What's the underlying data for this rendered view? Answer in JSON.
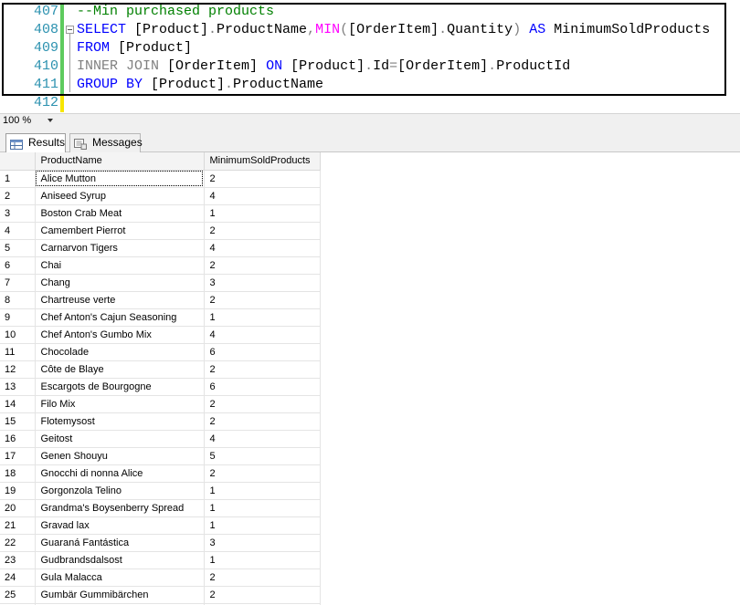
{
  "editor": {
    "lines": [
      {
        "number": "407",
        "tokens": [
          {
            "cls": "c",
            "text": "--Min purchased products"
          }
        ]
      },
      {
        "number": "408",
        "tokens": [
          {
            "cls": "k",
            "text": "SELECT "
          },
          {
            "cls": "t",
            "text": "[Product]"
          },
          {
            "cls": "g",
            "text": "."
          },
          {
            "cls": "t",
            "text": "ProductName"
          },
          {
            "cls": "g",
            "text": ","
          },
          {
            "cls": "f",
            "text": "MIN"
          },
          {
            "cls": "g",
            "text": "("
          },
          {
            "cls": "t",
            "text": "[OrderItem]"
          },
          {
            "cls": "g",
            "text": "."
          },
          {
            "cls": "t",
            "text": "Quantity"
          },
          {
            "cls": "g",
            "text": ") "
          },
          {
            "cls": "k",
            "text": "AS "
          },
          {
            "cls": "t",
            "text": "MinimumSoldProducts"
          }
        ]
      },
      {
        "number": "409",
        "tokens": [
          {
            "cls": "k",
            "text": "FROM "
          },
          {
            "cls": "t",
            "text": "[Product]"
          }
        ]
      },
      {
        "number": "410",
        "tokens": [
          {
            "cls": "g",
            "text": "INNER JOIN "
          },
          {
            "cls": "t",
            "text": "[OrderItem] "
          },
          {
            "cls": "k",
            "text": "ON "
          },
          {
            "cls": "t",
            "text": "[Product]"
          },
          {
            "cls": "g",
            "text": "."
          },
          {
            "cls": "t",
            "text": "Id"
          },
          {
            "cls": "g",
            "text": "="
          },
          {
            "cls": "t",
            "text": "[OrderItem]"
          },
          {
            "cls": "g",
            "text": "."
          },
          {
            "cls": "t",
            "text": "ProductId"
          }
        ]
      },
      {
        "number": "411",
        "tokens": [
          {
            "cls": "k",
            "text": "GROUP BY "
          },
          {
            "cls": "t",
            "text": "[Product]"
          },
          {
            "cls": "g",
            "text": "."
          },
          {
            "cls": "t",
            "text": "ProductName"
          }
        ]
      },
      {
        "number": "412",
        "tokens": []
      }
    ]
  },
  "zoom": {
    "value": "100 %"
  },
  "tabs": {
    "results": "Results",
    "messages": "Messages"
  },
  "grid": {
    "columns": [
      "ProductName",
      "MinimumSoldProducts"
    ],
    "rows": [
      [
        "1",
        "Alice Mutton",
        "2"
      ],
      [
        "2",
        "Aniseed Syrup",
        "4"
      ],
      [
        "3",
        "Boston Crab Meat",
        "1"
      ],
      [
        "4",
        "Camembert Pierrot",
        "2"
      ],
      [
        "5",
        "Carnarvon Tigers",
        "4"
      ],
      [
        "6",
        "Chai",
        "2"
      ],
      [
        "7",
        "Chang",
        "3"
      ],
      [
        "8",
        "Chartreuse verte",
        "2"
      ],
      [
        "9",
        "Chef Anton's Cajun Seasoning",
        "1"
      ],
      [
        "10",
        "Chef Anton's Gumbo Mix",
        "4"
      ],
      [
        "11",
        "Chocolade",
        "6"
      ],
      [
        "12",
        "Côte de Blaye",
        "2"
      ],
      [
        "13",
        "Escargots de Bourgogne",
        "6"
      ],
      [
        "14",
        "Filo Mix",
        "2"
      ],
      [
        "15",
        "Flotemysost",
        "2"
      ],
      [
        "16",
        "Geitost",
        "4"
      ],
      [
        "17",
        "Genen Shouyu",
        "5"
      ],
      [
        "18",
        "Gnocchi di nonna Alice",
        "2"
      ],
      [
        "19",
        "Gorgonzola Telino",
        "1"
      ],
      [
        "20",
        "Grandma's Boysenberry Spread",
        "1"
      ],
      [
        "21",
        "Gravad lax",
        "1"
      ],
      [
        "22",
        "Guaraná Fantástica",
        "3"
      ],
      [
        "23",
        "Gudbrandsdalsost",
        "1"
      ],
      [
        "24",
        "Gula Malacca",
        "2"
      ],
      [
        "25",
        "Gumbär Gummibärchen",
        "2"
      ],
      [
        "26",
        "",
        ""
      ]
    ]
  }
}
